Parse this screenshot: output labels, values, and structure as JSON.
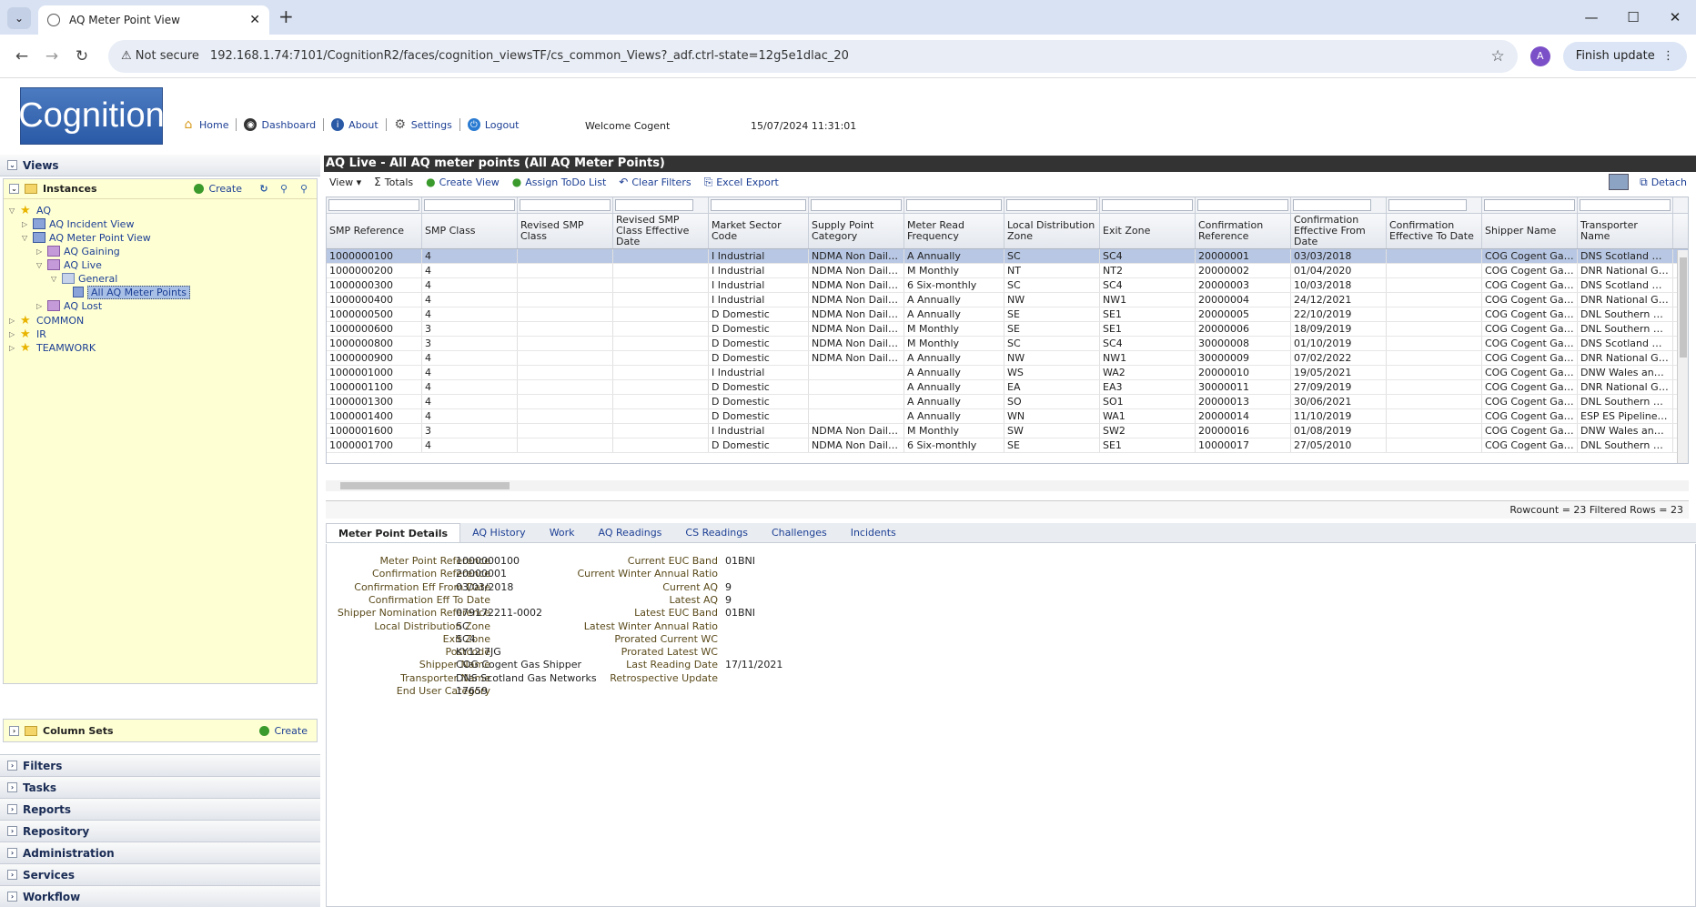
{
  "browser": {
    "tab_title": "AQ Meter Point View",
    "not_secure": "Not secure",
    "url": "192.168.1.74:7101/CognitionR2/faces/cognition_viewsTF/cs_common_Views?_adf.ctrl-state=12g5e1dlac_20",
    "avatar": "A",
    "finish_update": "Finish update"
  },
  "header": {
    "logo": "Cognition",
    "nav": [
      "Home",
      "Dashboard",
      "About",
      "Settings",
      "Logout"
    ],
    "welcome": "Welcome Cogent",
    "datetime": "15/07/2024 11:31:01"
  },
  "left": {
    "views": "Views",
    "instances": "Instances",
    "create": "Create",
    "tree": [
      "AQ",
      "AQ Incident View",
      "AQ Meter Point View",
      "AQ Gaining",
      "AQ Live",
      "General",
      "All AQ Meter Points",
      "AQ Lost",
      "COMMON",
      "IR",
      "TEAMWORK"
    ],
    "column_sets": "Column Sets",
    "column_sets_create": "Create",
    "accordions": [
      "Filters",
      "Tasks",
      "Reports",
      "Repository",
      "Administration",
      "Services",
      "Workflow"
    ]
  },
  "main": {
    "title": "AQ Live - All AQ meter points (All AQ Meter Points)",
    "toolbar": {
      "view": "View",
      "totals": "Totals",
      "create_view": "Create View",
      "assign": "Assign ToDo List",
      "clear": "Clear Filters",
      "excel": "Excel Export",
      "detach": "Detach"
    },
    "columns": [
      "SMP Reference",
      "SMP Class",
      "Revised SMP Class",
      "Revised SMP Class Effective Date",
      "Market Sector Code",
      "Supply Point Category",
      "Meter Read Frequency",
      "Local Distribution Zone",
      "Exit Zone",
      "Confirmation Reference",
      "Confirmation Effective From Date",
      "Confirmation Effective To Date",
      "Shipper Name",
      "Transporter Name"
    ],
    "rows": [
      [
        "1000000100",
        "4",
        "",
        "",
        "I Industrial",
        "NDMA Non Daily ...",
        "A Annually",
        "SC",
        "SC4",
        "20000001",
        "03/03/2018",
        "",
        "COG Cogent Gas S...",
        "DNS Scotland Gas ..."
      ],
      [
        "1000000200",
        "4",
        "",
        "",
        "I Industrial",
        "NDMA Non Daily ...",
        "M Monthly",
        "NT",
        "NT2",
        "20000002",
        "01/04/2020",
        "",
        "COG Cogent Gas S...",
        "DNR National Grid..."
      ],
      [
        "1000000300",
        "4",
        "",
        "",
        "I Industrial",
        "NDMA Non Daily ...",
        "6 Six-monthly",
        "SC",
        "SC4",
        "20000003",
        "10/03/2018",
        "",
        "COG Cogent Gas S...",
        "DNS Scotland Gas ..."
      ],
      [
        "1000000400",
        "4",
        "",
        "",
        "I Industrial",
        "NDMA Non Daily ...",
        "A Annually",
        "NW",
        "NW1",
        "20000004",
        "24/12/2021",
        "",
        "COG Cogent Gas S...",
        "DNR National Grid..."
      ],
      [
        "1000000500",
        "4",
        "",
        "",
        "D Domestic",
        "NDMA Non Daily ...",
        "A Annually",
        "SE",
        "SE1",
        "20000005",
        "22/10/2019",
        "",
        "COG Cogent Gas S...",
        "DNL Southern Gas..."
      ],
      [
        "1000000600",
        "3",
        "",
        "",
        "D Domestic",
        "NDMA Non Daily ...",
        "M Monthly",
        "SE",
        "SE1",
        "20000006",
        "18/09/2019",
        "",
        "COG Cogent Gas S...",
        "DNL Southern Gas..."
      ],
      [
        "1000000800",
        "3",
        "",
        "",
        "D Domestic",
        "NDMA Non Daily ...",
        "M Monthly",
        "SC",
        "SC4",
        "30000008",
        "01/10/2019",
        "",
        "COG Cogent Gas S...",
        "DNS Scotland Gas ..."
      ],
      [
        "1000000900",
        "4",
        "",
        "",
        "D Domestic",
        "NDMA Non Daily ...",
        "A Annually",
        "NW",
        "NW1",
        "30000009",
        "07/02/2022",
        "",
        "COG Cogent Gas S...",
        "DNR National Grid..."
      ],
      [
        "1000001000",
        "4",
        "",
        "",
        "I Industrial",
        "",
        "A Annually",
        "WS",
        "WA2",
        "20000010",
        "19/05/2021",
        "",
        "COG Cogent Gas S...",
        "DNW Wales and ..."
      ],
      [
        "1000001100",
        "4",
        "",
        "",
        "D Domestic",
        "",
        "A Annually",
        "EA",
        "EA3",
        "30000011",
        "27/09/2019",
        "",
        "COG Cogent Gas S...",
        "DNR National Grid..."
      ],
      [
        "1000001300",
        "4",
        "",
        "",
        "D Domestic",
        "",
        "A Annually",
        "SO",
        "SO1",
        "20000013",
        "30/06/2021",
        "",
        "COG Cogent Gas S...",
        "DNL Southern Gas..."
      ],
      [
        "1000001400",
        "4",
        "",
        "",
        "D Domestic",
        "",
        "A Annually",
        "WN",
        "WA1",
        "20000014",
        "11/10/2019",
        "",
        "COG Cogent Gas S...",
        "ESP ES Pipelines Ltd"
      ],
      [
        "1000001600",
        "3",
        "",
        "",
        "I Industrial",
        "NDMA Non Daily ...",
        "M Monthly",
        "SW",
        "SW2",
        "20000016",
        "01/08/2019",
        "",
        "COG Cogent Gas S...",
        "DNW Wales and ..."
      ],
      [
        "1000001700",
        "4",
        "",
        "",
        "D Domestic",
        "NDMA Non Daily ...",
        "6 Six-monthly",
        "SE",
        "SE1",
        "10000017",
        "27/05/2010",
        "",
        "COG Cogent Gas S...",
        "DNL Southern Gas..."
      ]
    ],
    "rowcount": "Rowcount = 23  Filtered Rows = 23",
    "tabs": [
      "Meter Point Details",
      "AQ History",
      "Work",
      "AQ Readings",
      "CS Readings",
      "Challenges",
      "Incidents"
    ],
    "details_left": [
      [
        "Meter Point Reference",
        "1000000100"
      ],
      [
        "Confirmation Reference",
        "20000001"
      ],
      [
        "Confirmation Eff From Date",
        "03/03/2018"
      ],
      [
        "Confirmation Eff To Date",
        ""
      ],
      [
        "Shipper Nomination Reference",
        "079172211-0002"
      ],
      [
        "Local Distribution Zone",
        "SC"
      ],
      [
        "Exit Zone",
        "SC4"
      ],
      [
        "Postcode",
        "KY12 7JG"
      ],
      [
        "Shipper Name",
        "COG Cogent Gas Shipper"
      ],
      [
        "Transporter Name",
        "DNS Scotland Gas Networks"
      ],
      [
        "End User Category",
        "17659"
      ]
    ],
    "details_right": [
      [
        "Current EUC Band",
        "01BNI"
      ],
      [
        "Current Winter Annual Ratio",
        ""
      ],
      [
        "Current AQ",
        "9"
      ],
      [
        "Latest AQ",
        "9"
      ],
      [
        "Latest EUC Band",
        "01BNI"
      ],
      [
        "Latest Winter Annual Ratio",
        ""
      ],
      [
        "Prorated Current WC",
        ""
      ],
      [
        "Prorated Latest WC",
        ""
      ],
      [
        "Last Reading Date",
        "17/11/2021"
      ],
      [
        "Retrospective Update",
        ""
      ]
    ]
  }
}
